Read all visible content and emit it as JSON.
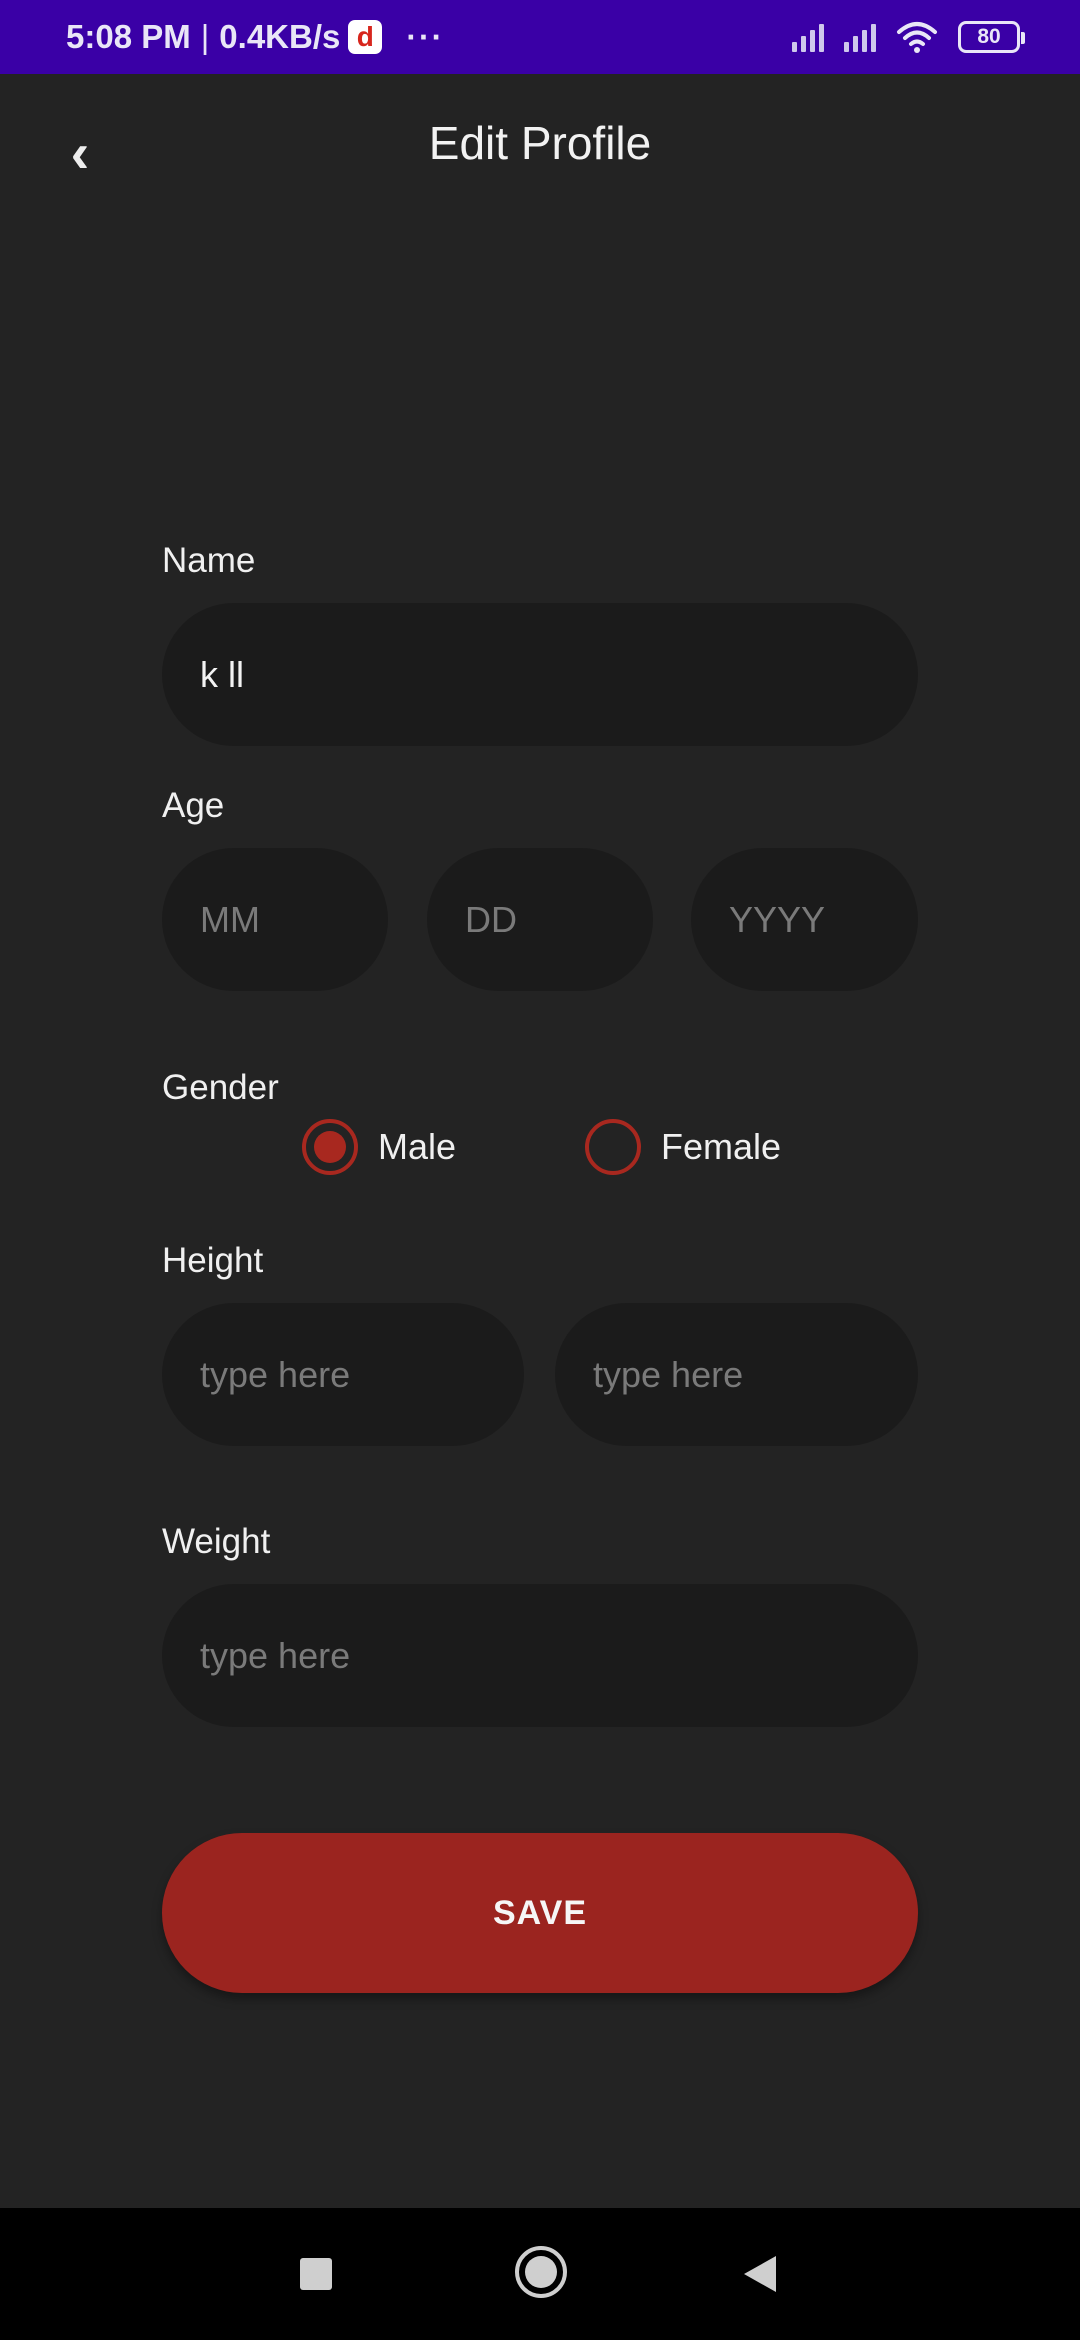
{
  "status_bar": {
    "time": "5:08 PM",
    "separator": "|",
    "net_speed": "0.4KB/s",
    "app_badge_letter": "d",
    "more": "···",
    "battery": "80",
    "bg_color": "#3a00a6"
  },
  "header": {
    "back_icon": "‹",
    "title": "Edit Profile"
  },
  "form": {
    "name": {
      "label": "Name",
      "value": "k ll"
    },
    "age": {
      "label": "Age",
      "month_placeholder": "MM",
      "day_placeholder": "DD",
      "year_placeholder": "YYYY"
    },
    "gender": {
      "label": "Gender",
      "options": [
        "Male",
        "Female"
      ],
      "selected": "Male"
    },
    "height": {
      "label": "Height",
      "first_placeholder": "type here",
      "second_placeholder": "type here"
    },
    "weight": {
      "label": "Weight",
      "placeholder": "type here"
    },
    "save_label": "SAVE"
  },
  "colors": {
    "background": "#232323",
    "field": "#1b1b1b",
    "accent": "#9b241f"
  },
  "nav": {
    "recent_icon": "square-icon",
    "home_icon": "circle-icon",
    "back_icon": "triangle-back-icon"
  }
}
